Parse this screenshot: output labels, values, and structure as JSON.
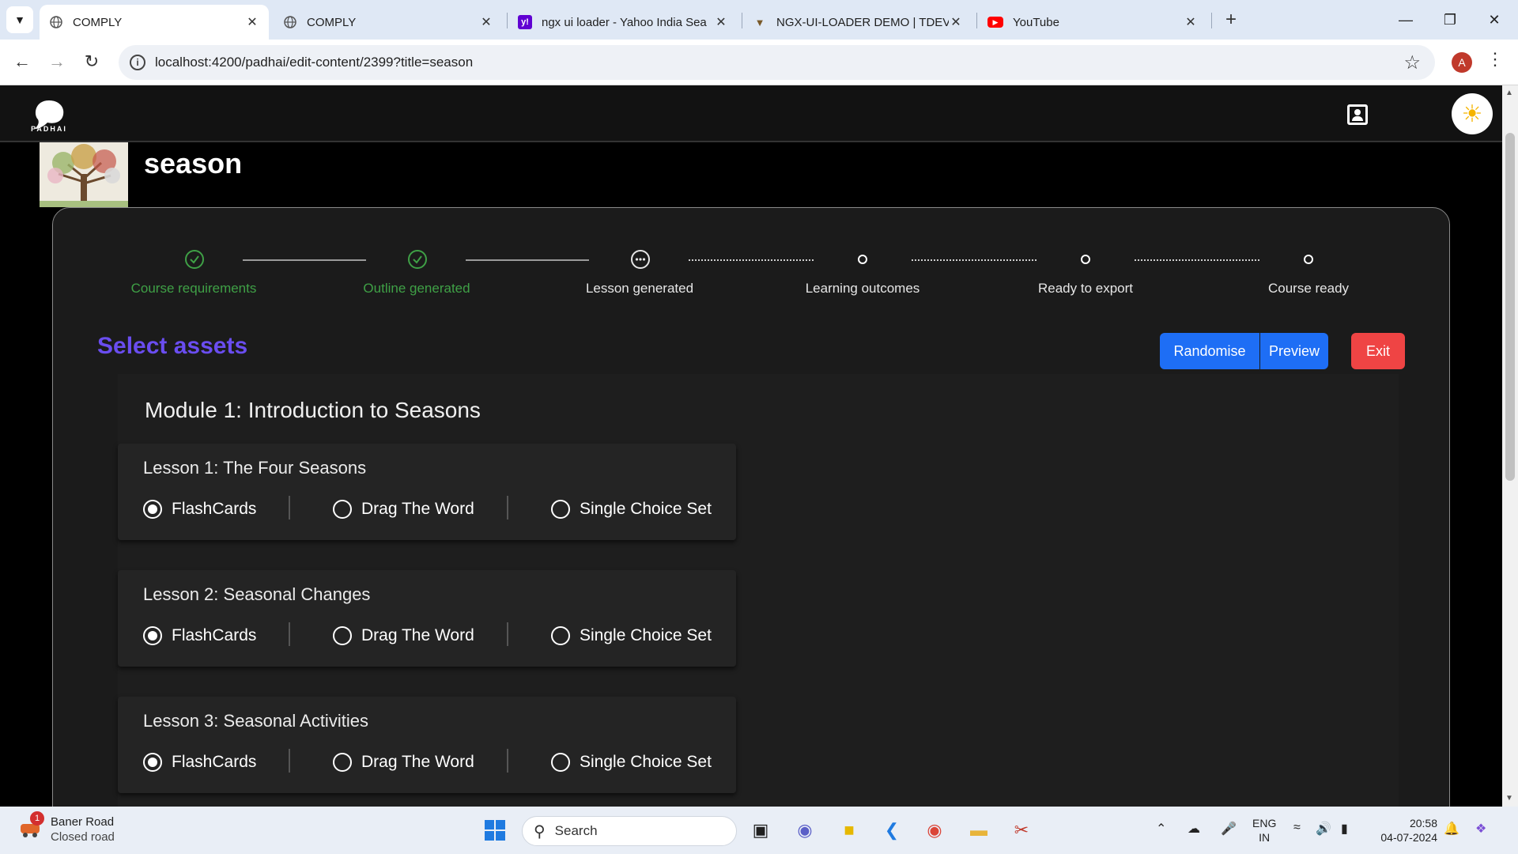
{
  "browser": {
    "tabs": [
      {
        "title": "COMPLY",
        "favicon": "globe-icon",
        "active": true
      },
      {
        "title": "COMPLY",
        "favicon": "globe-icon",
        "active": false
      },
      {
        "title": "ngx ui loader - Yahoo India Sea",
        "favicon": "yahoo-icon",
        "active": false
      },
      {
        "title": "NGX-UI-LOADER DEMO | TDEV",
        "favicon": "tdev-icon",
        "active": false
      },
      {
        "title": "YouTube",
        "favicon": "youtube-icon",
        "active": false
      }
    ],
    "url": "localhost:4200/padhai/edit-content/2399?title=season",
    "profile_initial": "A"
  },
  "app": {
    "logo_text": "PADHAI",
    "course_title": "season",
    "steps": [
      {
        "label": "Course requirements",
        "status": "done"
      },
      {
        "label": "Outline generated",
        "status": "done"
      },
      {
        "label": "Lesson generated",
        "status": "current"
      },
      {
        "label": "Learning outcomes",
        "status": "pending"
      },
      {
        "label": "Ready to export",
        "status": "pending"
      },
      {
        "label": "Course ready",
        "status": "pending"
      }
    ],
    "section_title": "Select assets",
    "buttons": {
      "randomise": "Randomise",
      "preview": "Preview",
      "exit": "Exit"
    },
    "module_title": "Module 1: Introduction to Seasons",
    "lessons": [
      {
        "title": "Lesson 1: The Four Seasons",
        "options": [
          "FlashCards",
          "Drag The Word",
          "Single Choice Set"
        ],
        "selected": "FlashCards"
      },
      {
        "title": "Lesson 2: Seasonal Changes",
        "options": [
          "FlashCards",
          "Drag The Word",
          "Single Choice Set"
        ],
        "selected": "FlashCards"
      },
      {
        "title": "Lesson 3: Seasonal Activities",
        "options": [
          "FlashCards",
          "Drag The Word",
          "Single Choice Set"
        ],
        "selected": "FlashCards"
      }
    ]
  },
  "taskbar": {
    "weather_title": "Baner Road",
    "weather_sub": "Closed road",
    "weather_badge": "1",
    "search_label": "Search",
    "lang_top": "ENG",
    "lang_bottom": "IN",
    "time": "20:58",
    "date": "04-07-2024"
  },
  "colors": {
    "accent": "#6a4df0",
    "done": "#3fa046",
    "primary_button": "#1e6ef5",
    "danger_button": "#ef4444"
  }
}
